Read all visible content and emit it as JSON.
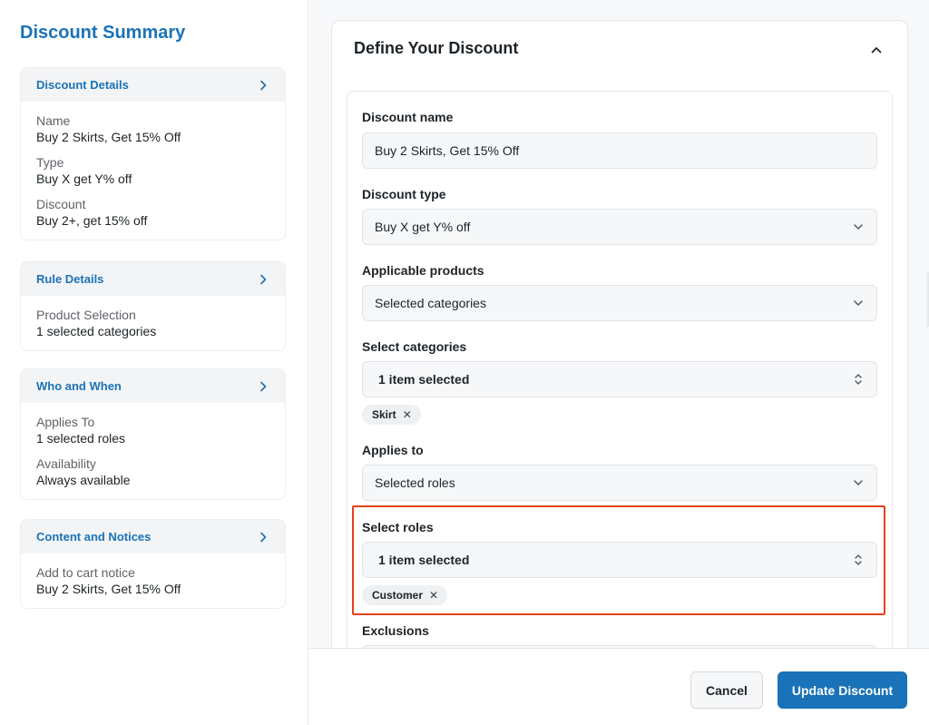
{
  "sidebar": {
    "title": "Discount Summary",
    "cards": [
      {
        "header": "Discount Details",
        "fields": [
          {
            "label": "Name",
            "value": "Buy 2 Skirts, Get 15% Off"
          },
          {
            "label": "Type",
            "value": "Buy X get Y% off"
          },
          {
            "label": "Discount",
            "value": "Buy 2+, get 15% off"
          }
        ]
      },
      {
        "header": "Rule Details",
        "fields": [
          {
            "label": "Product Selection",
            "value": "1 selected categories"
          }
        ]
      },
      {
        "header": "Who and When",
        "fields": [
          {
            "label": "Applies To",
            "value": "1 selected roles"
          },
          {
            "label": "Availability",
            "value": "Always available"
          }
        ]
      },
      {
        "header": "Content and Notices",
        "fields": [
          {
            "label": "Add to cart notice",
            "value": "Buy 2 Skirts, Get 15% Off"
          }
        ]
      }
    ]
  },
  "panel": {
    "title": "Define Your Discount",
    "collapse_icon": "chevron-up-icon"
  },
  "form": {
    "discount_name": {
      "label": "Discount name",
      "value": "Buy 2 Skirts, Get 15% Off"
    },
    "discount_type": {
      "label": "Discount type",
      "value": "Buy X get Y% off",
      "icon": "chevron-down-icon"
    },
    "applicable_products": {
      "label": "Applicable products",
      "value": "Selected categories",
      "icon": "chevron-down-icon"
    },
    "select_categories": {
      "label": "Select categories",
      "value": "1 item selected",
      "icon": "chevron-updown-icon",
      "chips": [
        "Skirt"
      ]
    },
    "applies_to": {
      "label": "Applies to",
      "value": "Selected roles",
      "icon": "chevron-down-icon"
    },
    "select_roles": {
      "label": "Select roles",
      "value": "1 item selected",
      "icon": "chevron-updown-icon",
      "chips": [
        "Customer"
      ]
    },
    "exclusions": {
      "label": "Exclusions"
    }
  },
  "chip_remove_glyph": "✕",
  "footer": {
    "cancel_label": "Cancel",
    "submit_label": "Update Discount"
  },
  "colors": {
    "accent": "#1a73b8",
    "highlight": "#e8401c"
  }
}
